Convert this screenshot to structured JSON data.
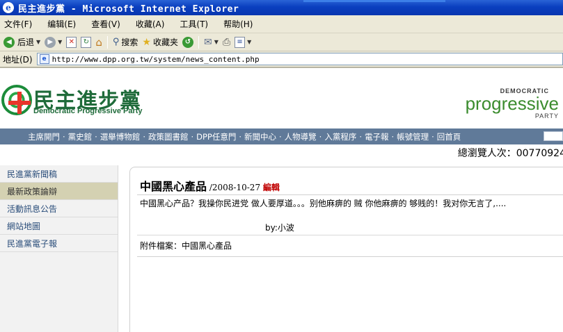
{
  "window": {
    "title": "民主進步黨 - Microsoft Internet Explorer"
  },
  "menubar": {
    "items": [
      "文件(F)",
      "编辑(E)",
      "查看(V)",
      "收藏(A)",
      "工具(T)",
      "帮助(H)"
    ]
  },
  "toolbar": {
    "back_label": "后退",
    "search_label": "搜索",
    "favorites_label": "收藏夹"
  },
  "address": {
    "label": "地址(D)",
    "url": "http://www.dpp.org.tw/system/news_content.php"
  },
  "header": {
    "logo_cn": "民主進步黨",
    "logo_en": "Democratic Progressive Party",
    "brand_top": "DEMOCRATIC",
    "brand_main": "progressive",
    "brand_bottom": "PARTY"
  },
  "nav": {
    "items": [
      "主席開門",
      "黨史館",
      "選舉博物館",
      "政策圖書館",
      "DPP任意門",
      "新聞中心",
      "人物導覽",
      "入黨程序",
      "電子報",
      "帳號管理",
      "回首頁"
    ]
  },
  "counter": {
    "text": "總瀏覽人次：00770924"
  },
  "sidebar": {
    "items": [
      {
        "label": "民進黨新聞稿",
        "active": false
      },
      {
        "label": "最新政策論辯",
        "active": true
      },
      {
        "label": "活動訊息公告",
        "active": false
      },
      {
        "label": "網站地圖",
        "active": false
      },
      {
        "label": "民進黨電子報",
        "active": false
      }
    ]
  },
  "article": {
    "title": "中國黑心產品",
    "date": "/2008-10-27",
    "edit": "編輯",
    "body": "中國黑心产品？我操你民进党 做人要厚道。。。别他麻痹的 贼 你他麻痹的 够贱的！我对你无言了,....",
    "author": "by:小波",
    "attachment": "附件檔案：中國黑心產品"
  },
  "colors": {
    "title_bar": "#0a3fbf",
    "chrome": "#ece9d8",
    "nav_bg": "#607a99",
    "sidebar_active": "#d4d1b2",
    "edit_red": "#c00000",
    "party_green": "#1f6b3a"
  }
}
